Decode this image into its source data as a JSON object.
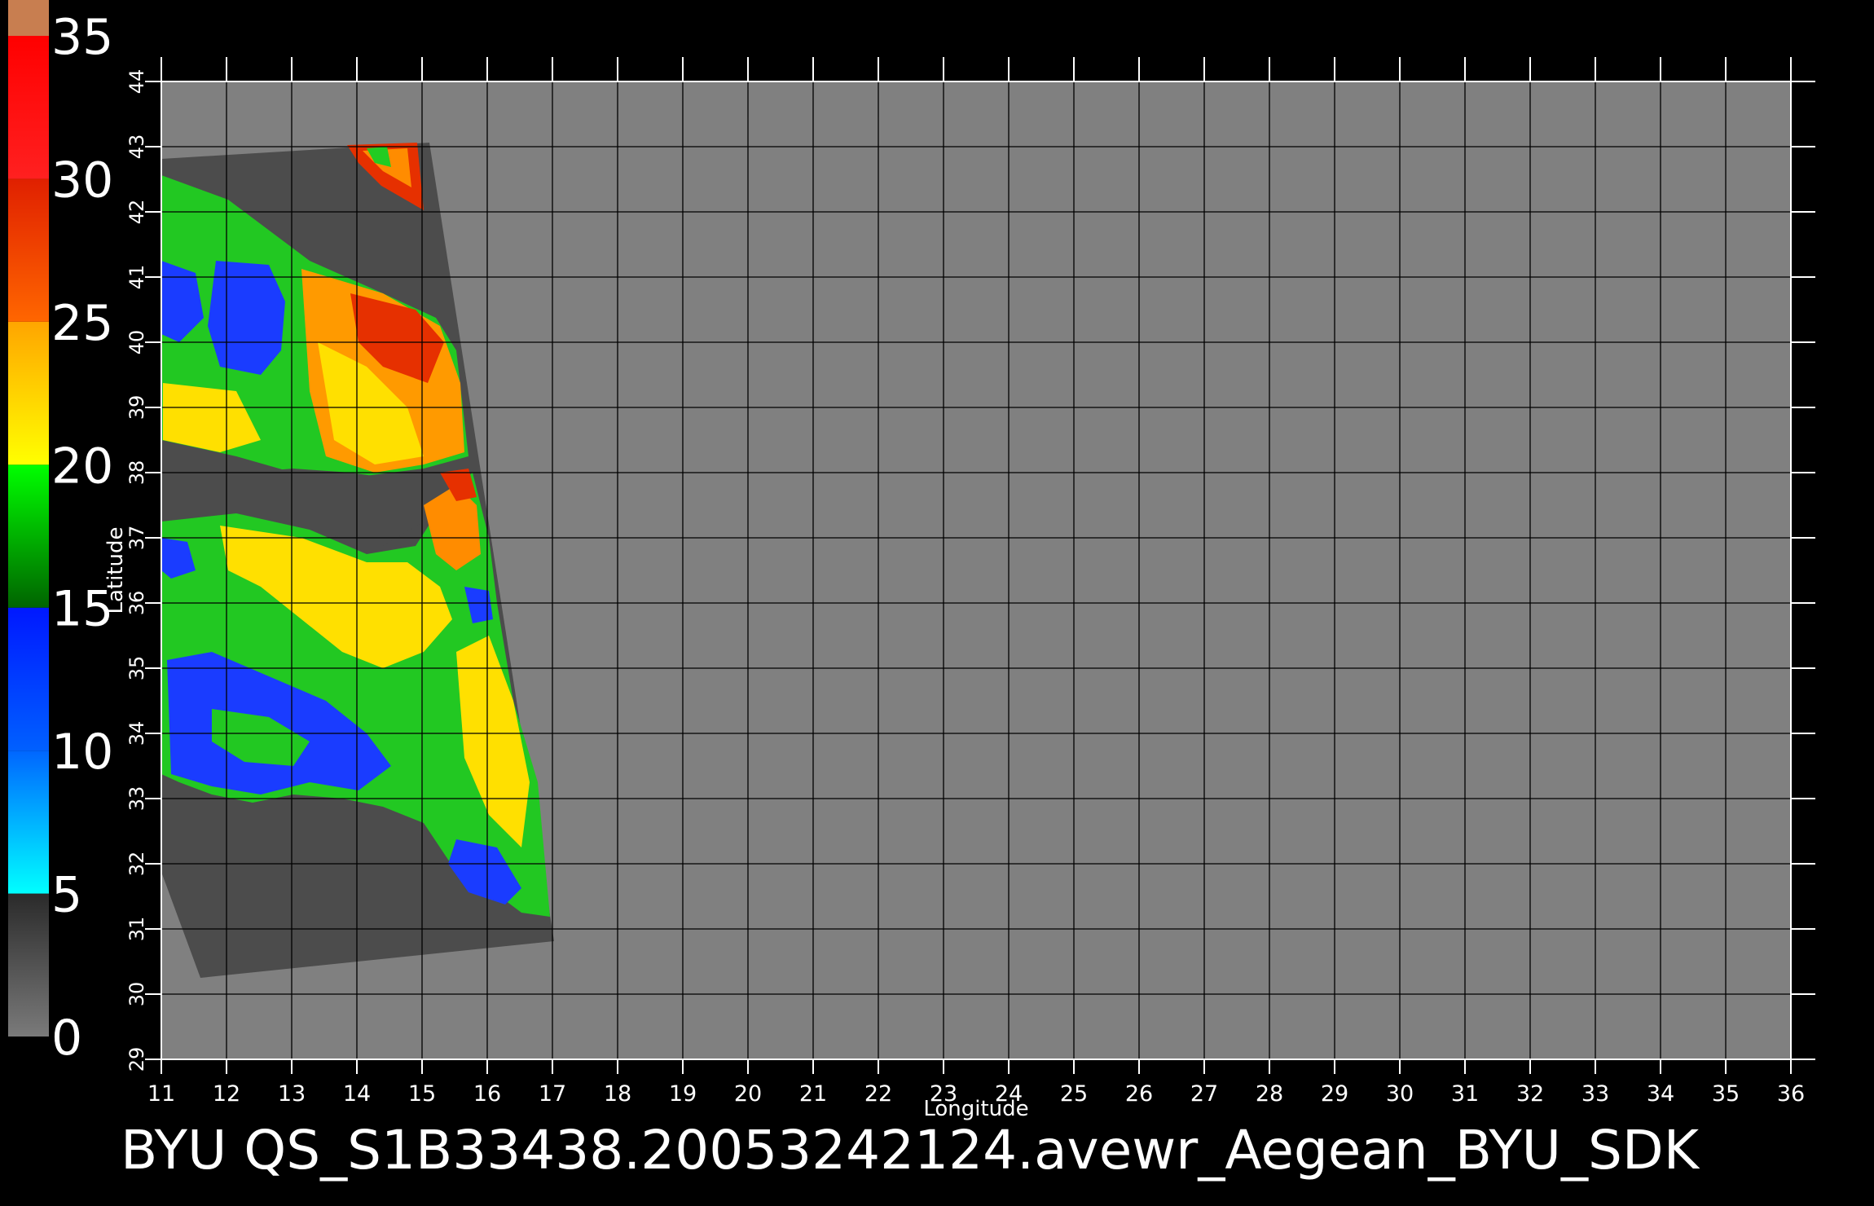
{
  "title": "BYU  QS_S1B33438.20053242124.avewr_Aegean_BYU_SDK",
  "x_axis": {
    "label": "Longitude",
    "ticks": [
      "11",
      "12",
      "13",
      "14",
      "15",
      "16",
      "17",
      "18",
      "19",
      "20",
      "21",
      "22",
      "23",
      "24",
      "25",
      "26",
      "27",
      "28",
      "29",
      "30",
      "31",
      "32",
      "33",
      "34",
      "35",
      "36"
    ],
    "range": [
      11,
      36
    ]
  },
  "y_axis": {
    "label": "Latitude",
    "ticks": [
      "29",
      "30",
      "31",
      "32",
      "33",
      "34",
      "35",
      "36",
      "37",
      "38",
      "39",
      "40",
      "41",
      "42",
      "43",
      "44"
    ],
    "range": [
      29,
      44
    ]
  },
  "colorbar": {
    "labels": [
      "0",
      "5",
      "10",
      "15",
      "20",
      "25",
      "30",
      "35"
    ],
    "range": [
      0,
      35
    ],
    "segments": [
      {
        "from": 0,
        "to": 5,
        "color_start": "#7a7a7a",
        "color_end": "#2a2a2a"
      },
      {
        "from": 5,
        "to": 10,
        "color_start": "#00ffff",
        "color_end": "#0066ff"
      },
      {
        "from": 10,
        "to": 15,
        "color_start": "#0060ff",
        "color_end": "#0018ff"
      },
      {
        "from": 15,
        "to": 20,
        "color_start": "#006400",
        "color_end": "#00ff00"
      },
      {
        "from": 20,
        "to": 25,
        "color_start": "#ffff00",
        "color_end": "#ffa500"
      },
      {
        "from": 25,
        "to": 30,
        "color_start": "#ff6600",
        "color_end": "#e02000"
      },
      {
        "from": 30,
        "to": 35,
        "color_start": "#ff2020",
        "color_end": "#ff0000"
      }
    ],
    "top_cap_color": "#c87e50"
  },
  "colors": {
    "background": "#000000",
    "map_fill": "#808080",
    "swath_fill": "#4c4c4c",
    "grid": "#000000",
    "text": "#ffffff"
  }
}
